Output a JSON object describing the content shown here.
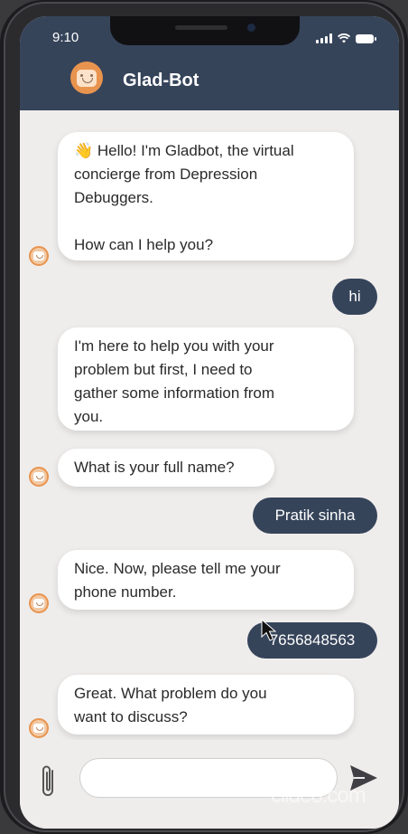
{
  "status_bar": {
    "time": "9:10"
  },
  "header": {
    "title": "Glad-Bot",
    "avatar_icon": "bot-face-icon"
  },
  "messages": [
    {
      "sender": "bot",
      "lines": [
        "👋 Hello! I'm Gladbot, the virtual",
        "concierge from  Depression",
        "Debuggers.",
        "",
        "How can I help you?"
      ]
    },
    {
      "sender": "user",
      "text": "hi"
    },
    {
      "sender": "bot",
      "lines": [
        "I'm here to help you with your",
        "problem but first, I need to",
        "gather some information from",
        "you."
      ]
    },
    {
      "sender": "bot",
      "lines": [
        "What is your full name?"
      ]
    },
    {
      "sender": "user",
      "text": "Pratik sinha"
    },
    {
      "sender": "bot",
      "lines": [
        "Nice. Now, please tell me your",
        "phone number."
      ]
    },
    {
      "sender": "user",
      "text": "7656848563"
    },
    {
      "sender": "bot",
      "lines": [
        "Great. What problem do you",
        "want to discuss?"
      ]
    }
  ],
  "composer": {
    "value": "",
    "placeholder": "",
    "attach_icon": "paperclip-icon",
    "send_icon": "send-icon"
  },
  "watermark": "clideo.com",
  "colors": {
    "header": "#36445a",
    "user_bubble": "#36445a",
    "accent": "#e8944f",
    "background": "#efedec"
  }
}
